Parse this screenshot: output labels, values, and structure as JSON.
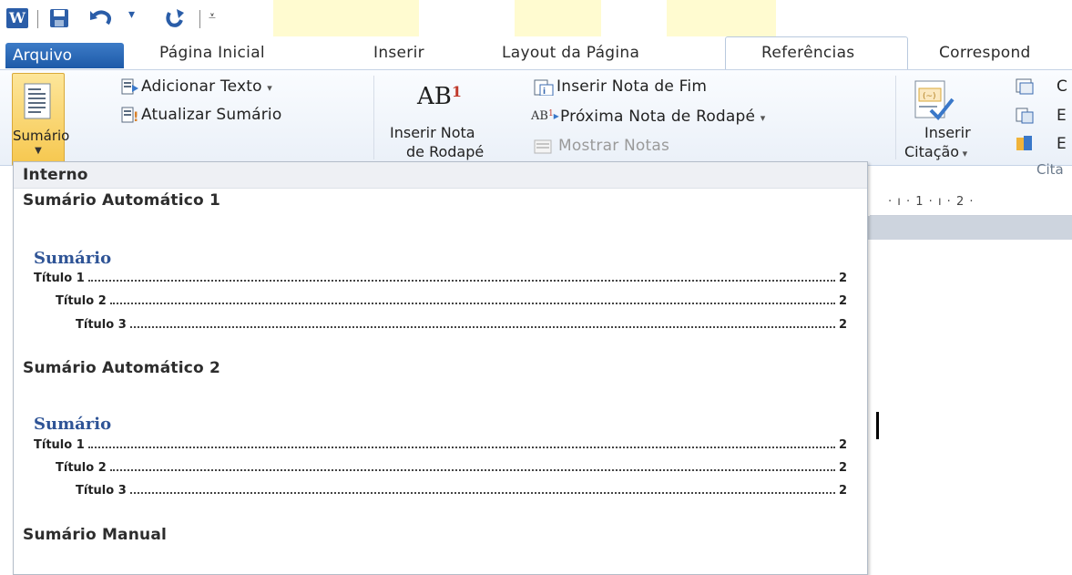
{
  "quick_access": {
    "app_icon": "word-icon",
    "items": [
      "save-icon",
      "undo-icon",
      "redo-icon",
      "customize-icon"
    ]
  },
  "tabs": {
    "file": "Arquivo",
    "home": "Página Inicial",
    "insert": "Inserir",
    "layout": "Layout da Página",
    "references": "Referências",
    "mailings": "Correspond"
  },
  "ribbon": {
    "toc_button": "Sumário",
    "add_text": "Adicionar Texto",
    "update_toc": "Atualizar Sumário",
    "insert_footnote_line1": "Inserir Nota",
    "insert_footnote_line2": "de Rodapé",
    "footnote_glyph": "AB",
    "footnote_super": "1",
    "insert_endnote": "Inserir Nota de Fim",
    "next_footnote": "Próxima Nota de Rodapé",
    "show_notes": "Mostrar Notas",
    "insert_citation_line1": "Inserir",
    "insert_citation_line2": "Citação",
    "citations_group_partial": "Cita",
    "cut_letter_1": "C",
    "cut_letter_2": "E",
    "cut_letter_3": "E"
  },
  "ruler": {
    "text": "· ı · 1 · ı · 2 ·"
  },
  "gallery": {
    "section": "Interno",
    "items": [
      {
        "title": "Sumário Automático 1",
        "preview_heading": "Sumário",
        "entries": [
          {
            "label": "Título 1",
            "page": "2"
          },
          {
            "label": "Título 2",
            "page": "2"
          },
          {
            "label": "Título 3",
            "page": "2"
          }
        ]
      },
      {
        "title": "Sumário Automático 2",
        "preview_heading": "Sumário",
        "entries": [
          {
            "label": "Título 1",
            "page": "2"
          },
          {
            "label": "Título 2",
            "page": "2"
          },
          {
            "label": "Título 3",
            "page": "2"
          }
        ]
      },
      {
        "title": "Sumário Manual"
      }
    ]
  },
  "colors": {
    "file_tab": "#2a67b3",
    "accent": "#f6c74e",
    "preview_heading": "#2f5496",
    "footnote_super": "#c0392b"
  }
}
